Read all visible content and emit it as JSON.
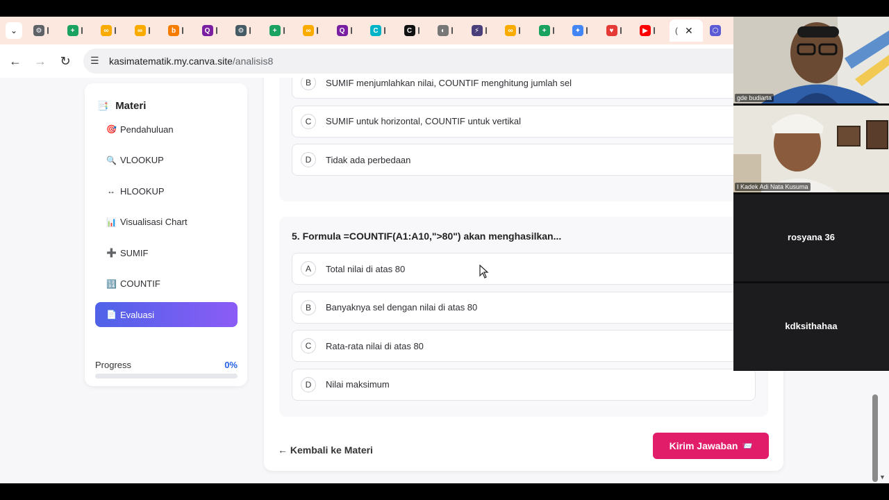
{
  "browser": {
    "active_tab_initial": "(",
    "url_domain": "kasimatematik.my.canva.site",
    "url_path": "/analisis8",
    "tab_favicons": [
      {
        "name": "chrome",
        "color": "#5f6368",
        "glyph": "⚙",
        "letter": "V"
      },
      {
        "name": "sheets",
        "color": "#1aa260",
        "glyph": "+",
        "letter": ""
      },
      {
        "name": "colab",
        "color": "#f9ab00",
        "glyph": "∞",
        "letter": ""
      },
      {
        "name": "colab",
        "color": "#f9ab00",
        "glyph": "∞",
        "letter": ""
      },
      {
        "name": "blogger",
        "color": "#f57c00",
        "glyph": "b",
        "letter": ""
      },
      {
        "name": "quiz",
        "color": "#7b1fa2",
        "glyph": "Q",
        "letter": ""
      },
      {
        "name": "edu",
        "color": "#455a64",
        "glyph": "⚙",
        "letter": "t"
      },
      {
        "name": "sheets",
        "color": "#1aa260",
        "glyph": "+",
        "letter": "L"
      },
      {
        "name": "colab",
        "color": "#f9ab00",
        "glyph": "∞",
        "letter": ""
      },
      {
        "name": "quiz",
        "color": "#7b1fa2",
        "glyph": "Q",
        "letter": "L"
      },
      {
        "name": "canva",
        "color": "#00b3c7",
        "glyph": "C",
        "letter": ""
      },
      {
        "name": "circle",
        "color": "#111111",
        "glyph": "C",
        "letter": "L"
      },
      {
        "name": "circle-grey",
        "color": "#777777",
        "glyph": "◐",
        "letter": "t"
      },
      {
        "name": "bolt",
        "color": "#4a3f7a",
        "glyph": "⚡",
        "letter": ""
      },
      {
        "name": "colab",
        "color": "#f9ab00",
        "glyph": "∞",
        "letter": ""
      },
      {
        "name": "sheets",
        "color": "#1aa260",
        "glyph": "+",
        "letter": ""
      },
      {
        "name": "gemini",
        "color": "#4285f4",
        "glyph": "✦",
        "letter": ""
      },
      {
        "name": "heart",
        "color": "#e53935",
        "glyph": "♥",
        "letter": ""
      },
      {
        "name": "youtube",
        "color": "#ff0000",
        "glyph": "▶",
        "letter": ""
      }
    ]
  },
  "sidebar": {
    "title": "Materi",
    "items": [
      {
        "label": "Pendahuluan",
        "icon": "🎯"
      },
      {
        "label": "VLOOKUP",
        "icon": "🔍"
      },
      {
        "label": "HLOOKUP",
        "icon": "↔"
      },
      {
        "label": "Visualisasi Chart",
        "icon": "📊"
      },
      {
        "label": "SUMIF",
        "icon": "➕"
      },
      {
        "label": "COUNTIF",
        "icon": "🔢"
      },
      {
        "label": "Evaluasi",
        "icon": "📄"
      }
    ],
    "progress_label": "Progress",
    "progress_value": "0%",
    "progress_fraction": 0
  },
  "quiz": {
    "prev_options": [
      {
        "letter": "B",
        "text": "SUMIF menjumlahkan nilai, COUNTIF menghitung jumlah sel"
      },
      {
        "letter": "C",
        "text": "SUMIF untuk horizontal, COUNTIF untuk vertikal"
      },
      {
        "letter": "D",
        "text": "Tidak ada perbedaan"
      }
    ],
    "question5": {
      "title": "5. Formula =COUNTIF(A1:A10,\">80\") akan menghasilkan...",
      "options": [
        {
          "letter": "A",
          "text": "Total nilai di atas 80"
        },
        {
          "letter": "B",
          "text": "Banyaknya sel dengan nilai di atas 80"
        },
        {
          "letter": "C",
          "text": "Rata-rata nilai di atas 80"
        },
        {
          "letter": "D",
          "text": "Nilai maksimum"
        }
      ]
    },
    "back_label": "← Kembali ke Materi",
    "submit_label": "Kirim Jawaban",
    "submit_icon": "📨"
  },
  "meeting": {
    "participants": [
      {
        "name": "gde budiarta"
      },
      {
        "name": "I Kadek Adi Nata Kusuma"
      },
      {
        "name": "rosyana 36"
      },
      {
        "name": "kdksithahaa"
      }
    ]
  }
}
